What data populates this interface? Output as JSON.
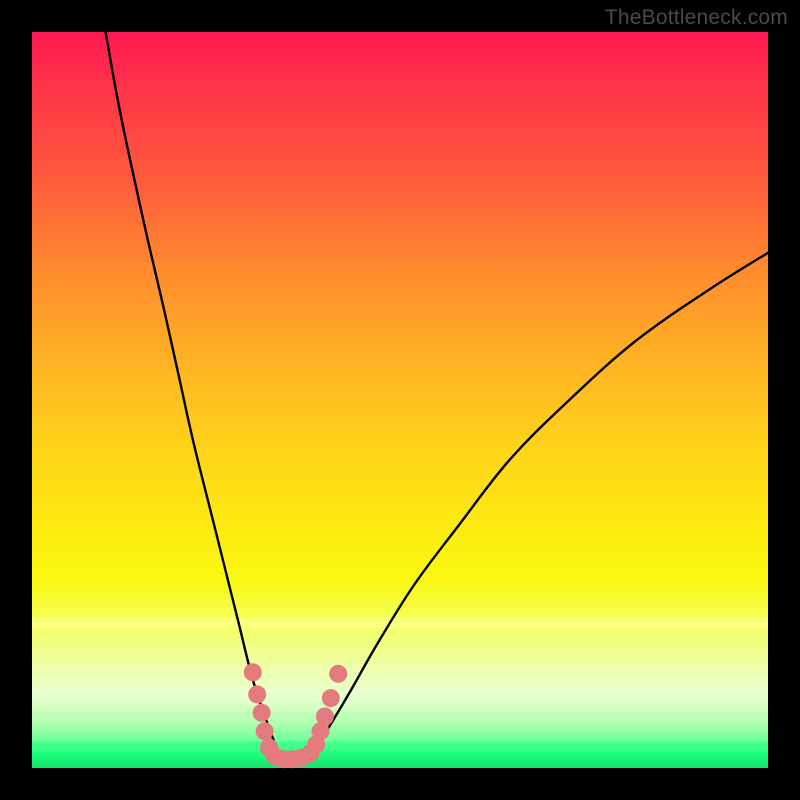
{
  "watermark": {
    "text": "TheBottleneck.com"
  },
  "colors": {
    "curve_stroke": "#000000",
    "marker_fill": "#e47a7d",
    "marker_stroke": "#c96164",
    "bg_black": "#000000"
  },
  "chart_data": {
    "type": "line",
    "title": "",
    "xlabel": "",
    "ylabel": "",
    "xlim": [
      0,
      100
    ],
    "ylim": [
      0,
      100
    ],
    "note": "Two curves descending into a V-shaped trough near x≈34; y≈0 is the green zone at bottom. Axes are unlabeled; values are visual estimates from pixel positions.",
    "series": [
      {
        "name": "left_curve",
        "x": [
          10,
          12,
          15,
          18,
          20,
          22,
          25,
          28,
          30,
          32,
          33.5
        ],
        "y": [
          100,
          89,
          75,
          62,
          53,
          44,
          32,
          20,
          12,
          6,
          2
        ]
      },
      {
        "name": "right_curve",
        "x": [
          38,
          40,
          43,
          47,
          52,
          58,
          65,
          73,
          82,
          92,
          100
        ],
        "y": [
          2,
          5,
          10,
          17,
          25,
          33,
          42,
          50,
          58,
          65,
          70
        ]
      }
    ],
    "markers": {
      "name": "trough_points",
      "points": [
        {
          "x": 30.0,
          "y": 13.0
        },
        {
          "x": 30.6,
          "y": 10.0
        },
        {
          "x": 31.2,
          "y": 7.5
        },
        {
          "x": 31.6,
          "y": 5.0
        },
        {
          "x": 32.2,
          "y": 2.8
        },
        {
          "x": 33.0,
          "y": 1.6
        },
        {
          "x": 34.2,
          "y": 1.2
        },
        {
          "x": 35.4,
          "y": 1.2
        },
        {
          "x": 36.6,
          "y": 1.4
        },
        {
          "x": 37.8,
          "y": 2.0
        },
        {
          "x": 38.6,
          "y": 3.2
        },
        {
          "x": 39.2,
          "y": 5.0
        },
        {
          "x": 39.8,
          "y": 7.0
        },
        {
          "x": 40.6,
          "y": 9.5
        },
        {
          "x": 41.6,
          "y": 12.8
        }
      ]
    }
  }
}
